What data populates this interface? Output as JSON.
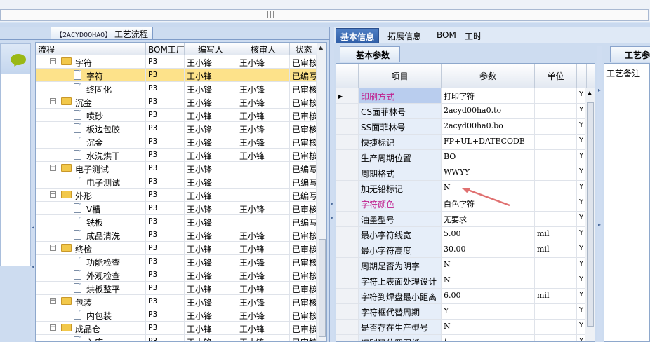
{
  "left_panel": {
    "title_code": "【2ACYDOOHAO】",
    "title_text": "工艺流程",
    "columns": [
      "流程",
      "BOM工厂",
      "编写人",
      "核审人",
      "状态"
    ],
    "rows": [
      {
        "label": "字符",
        "type": "folder",
        "expander": "−",
        "level": 1,
        "bom": "P3",
        "writer": "王小锋",
        "reviewer": "王小锋",
        "status": "已审核"
      },
      {
        "label": "字符",
        "type": "doc",
        "level": 2,
        "bom": "P3",
        "writer": "王小锋",
        "reviewer": "",
        "status": "已编写",
        "selected": true
      },
      {
        "label": "终固化",
        "type": "doc",
        "level": 2,
        "bom": "P3",
        "writer": "王小锋",
        "reviewer": "王小锋",
        "status": "已审核"
      },
      {
        "label": "沉金",
        "type": "folder",
        "expander": "−",
        "level": 1,
        "bom": "P3",
        "writer": "王小锋",
        "reviewer": "王小锋",
        "status": "已审核"
      },
      {
        "label": "喷砂",
        "type": "doc",
        "level": 2,
        "bom": "P3",
        "writer": "王小锋",
        "reviewer": "王小锋",
        "status": "已审核"
      },
      {
        "label": "板边包胶",
        "type": "doc",
        "level": 2,
        "bom": "P3",
        "writer": "王小锋",
        "reviewer": "王小锋",
        "status": "已审核"
      },
      {
        "label": "沉金",
        "type": "doc",
        "level": 2,
        "bom": "P3",
        "writer": "王小锋",
        "reviewer": "王小锋",
        "status": "已审核"
      },
      {
        "label": "水洗烘干",
        "type": "doc",
        "level": 2,
        "bom": "P3",
        "writer": "王小锋",
        "reviewer": "王小锋",
        "status": "已审核"
      },
      {
        "label": "电子测试",
        "type": "folder",
        "expander": "−",
        "level": 1,
        "bom": "P3",
        "writer": "王小锋",
        "reviewer": "",
        "status": "已编写"
      },
      {
        "label": "电子测试",
        "type": "doc",
        "level": 2,
        "bom": "P3",
        "writer": "王小锋",
        "reviewer": "",
        "status": "已编写"
      },
      {
        "label": "外形",
        "type": "folder",
        "expander": "−",
        "level": 1,
        "bom": "P3",
        "writer": "王小锋",
        "reviewer": "",
        "status": "已编写"
      },
      {
        "label": "V槽",
        "type": "doc",
        "level": 2,
        "bom": "P3",
        "writer": "王小锋",
        "reviewer": "王小锋",
        "status": "已审核"
      },
      {
        "label": "铣板",
        "type": "doc",
        "level": 2,
        "bom": "P3",
        "writer": "王小锋",
        "reviewer": "",
        "status": "已编写"
      },
      {
        "label": "成品清洗",
        "type": "doc",
        "level": 2,
        "bom": "P3",
        "writer": "王小锋",
        "reviewer": "王小锋",
        "status": "已审核"
      },
      {
        "label": "终检",
        "type": "folder",
        "expander": "−",
        "level": 1,
        "bom": "P3",
        "writer": "王小锋",
        "reviewer": "王小锋",
        "status": "已审核"
      },
      {
        "label": "功能检查",
        "type": "doc",
        "level": 2,
        "bom": "P3",
        "writer": "王小锋",
        "reviewer": "王小锋",
        "status": "已审核"
      },
      {
        "label": "外观检查",
        "type": "doc",
        "level": 2,
        "bom": "P3",
        "writer": "王小锋",
        "reviewer": "王小锋",
        "status": "已审核"
      },
      {
        "label": "烘板整平",
        "type": "doc",
        "level": 2,
        "bom": "P3",
        "writer": "王小锋",
        "reviewer": "王小锋",
        "status": "已审核"
      },
      {
        "label": "包装",
        "type": "folder",
        "expander": "−",
        "level": 1,
        "bom": "P3",
        "writer": "王小锋",
        "reviewer": "王小锋",
        "status": "已审核"
      },
      {
        "label": "内包装",
        "type": "doc",
        "level": 2,
        "bom": "P3",
        "writer": "王小锋",
        "reviewer": "王小锋",
        "status": "已审核"
      },
      {
        "label": "成品仓",
        "type": "folder",
        "expander": "−",
        "level": 1,
        "bom": "P3",
        "writer": "王小锋",
        "reviewer": "王小锋",
        "status": "已审核"
      },
      {
        "label": "入库",
        "type": "doc",
        "level": 2,
        "bom": "P3",
        "writer": "王小锋",
        "reviewer": "王小锋",
        "status": "已审核"
      }
    ]
  },
  "right_panel": {
    "tabs": [
      "基本信息",
      "拓展信息",
      "BOM",
      "工时"
    ],
    "active_tab": 0,
    "subtab": "基本参数",
    "side_tab": "工艺参",
    "notes_label": "工艺备注",
    "columns": [
      "项目",
      "参数",
      "单位"
    ],
    "rows": [
      {
        "item": "印刷方式",
        "value": "打印字符",
        "unit": "",
        "flag": "Y",
        "pink": true,
        "current": true
      },
      {
        "item": "CS面菲林号",
        "value": "2acyd00ha0.to",
        "unit": "",
        "flag": "Y"
      },
      {
        "item": "SS面菲林号",
        "value": "2acyd00ha0.bo",
        "unit": "",
        "flag": "Y"
      },
      {
        "item": "快捷标记",
        "value": "FP+UL+DATECODE",
        "unit": "",
        "flag": "Y"
      },
      {
        "item": "生产周期位置",
        "value": "BO",
        "unit": "",
        "flag": "Y"
      },
      {
        "item": "周期格式",
        "value": "WWYY",
        "unit": "",
        "flag": "Y"
      },
      {
        "item": "加无铅标记",
        "value": "N",
        "unit": "",
        "flag": "Y"
      },
      {
        "item": "字符颜色",
        "value": "白色字符",
        "unit": "",
        "flag": "Y",
        "pink": true
      },
      {
        "item": "油墨型号",
        "value": "无要求",
        "unit": "",
        "flag": "Y"
      },
      {
        "item": "最小字符线宽",
        "value": "5.00",
        "unit": "mil",
        "flag": "Y"
      },
      {
        "item": "最小字符高度",
        "value": "30.00",
        "unit": "mil",
        "flag": "Y"
      },
      {
        "item": "周期是否为阴字",
        "value": "N",
        "unit": "",
        "flag": "Y"
      },
      {
        "item": "字符上表面处理设计",
        "value": "N",
        "unit": "",
        "flag": "Y"
      },
      {
        "item": "字符到焊盘最小距离",
        "value": "6.00",
        "unit": "mil",
        "flag": "Y"
      },
      {
        "item": "字符框代替周期",
        "value": "Y",
        "unit": "",
        "flag": "Y"
      },
      {
        "item": "是否存在生产型号",
        "value": "N",
        "unit": "",
        "flag": "Y"
      },
      {
        "item": "识别码位置图纸",
        "value": "/",
        "unit": "",
        "flag": "Y"
      }
    ]
  },
  "colors": {
    "selected_row": "#fde28a",
    "active_tab": "#3a68b0",
    "pink_label": "#c0208e",
    "annotation_arrow": "#e07070"
  }
}
